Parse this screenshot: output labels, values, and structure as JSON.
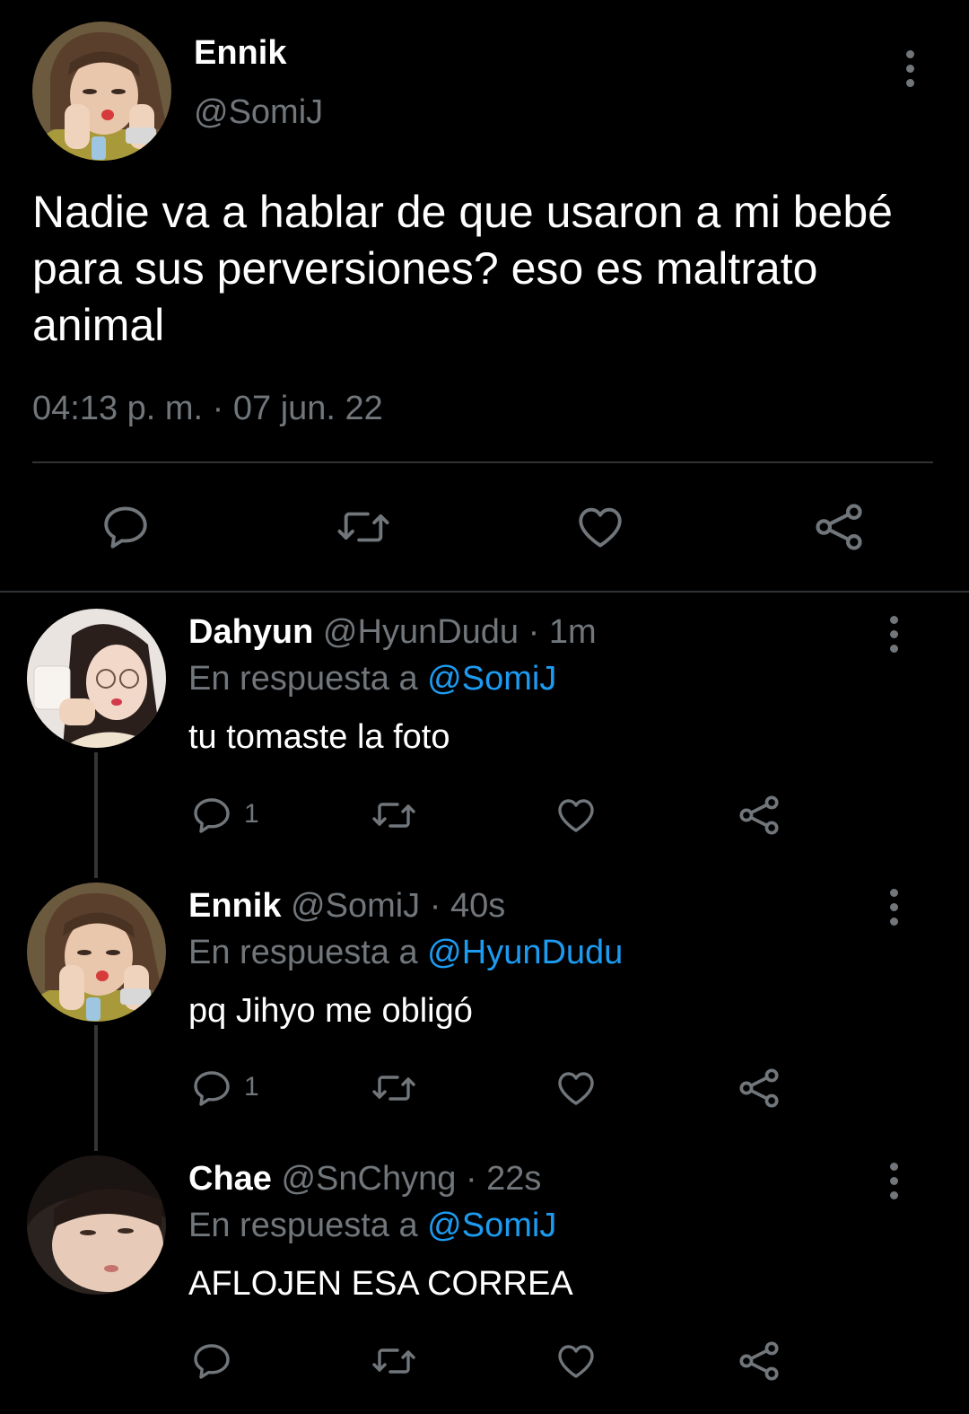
{
  "main_tweet": {
    "name": "Ennik",
    "handle": "@SomiJ",
    "text": "Nadie va a hablar de que usaron a mi bebé para sus perversiones? eso es maltrato animal",
    "timestamp": "04:13 p. m. · 07 jun. 22"
  },
  "replies": [
    {
      "name": "Dahyun",
      "handle": "@HyunDudu",
      "time": "· 1m",
      "reply_prefix": "En respuesta a",
      "reply_to": "@SomiJ",
      "text": "tu tomaste la foto",
      "reply_count": "1"
    },
    {
      "name": "Ennik",
      "handle": "@SomiJ",
      "time": "· 40s",
      "reply_prefix": "En respuesta a",
      "reply_to": "@HyunDudu",
      "text": "pq Jihyo me obligó",
      "reply_count": "1"
    },
    {
      "name": "Chae",
      "handle": "@SnChyng",
      "time": "· 22s",
      "reply_prefix": "En respuesta a",
      "reply_to": "@SomiJ",
      "text": "AFLOJEN ESA CORREA",
      "reply_count": ""
    }
  ],
  "icons": [
    "reply-icon",
    "retweet-icon",
    "like-icon",
    "share-icon",
    "more-icon"
  ],
  "colors": {
    "background": "#000000",
    "text": "#e7e9ea",
    "muted": "#71767b",
    "link": "#1d9bf0",
    "divider": "#2f3336"
  }
}
